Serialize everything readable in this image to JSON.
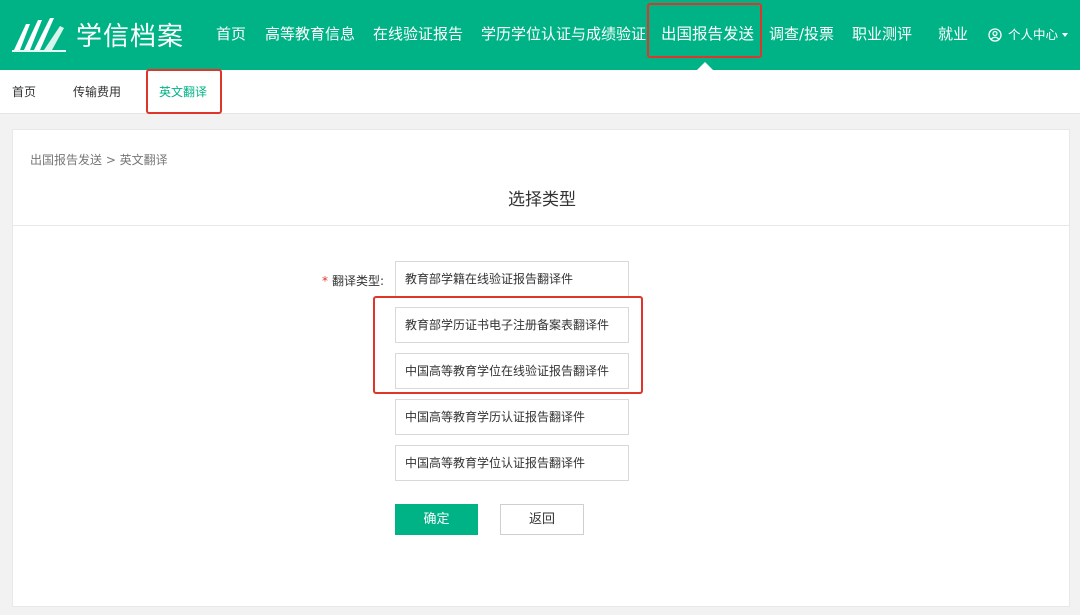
{
  "header": {
    "logo_text": "学信档案",
    "nav": [
      {
        "label": "首页"
      },
      {
        "label": "高等教育信息"
      },
      {
        "label": "在线验证报告"
      },
      {
        "label": "学历学位认证与成绩验证"
      },
      {
        "label": "出国报告发送",
        "active": true
      },
      {
        "label": "调查/投票"
      },
      {
        "label": "职业测评"
      },
      {
        "label": "就业"
      }
    ],
    "user_center": "个人中心",
    "brand_color": "#00b386"
  },
  "subnav": {
    "items": [
      {
        "label": "首页"
      },
      {
        "label": "传输费用"
      },
      {
        "label": "英文翻译",
        "active": true
      }
    ]
  },
  "main": {
    "breadcrumb": "出国报告发送 > 英文翻译",
    "title": "选择类型",
    "form": {
      "required_mark": "*",
      "label": "翻译类型:",
      "options": [
        {
          "label": "教育部学籍在线验证报告翻译件"
        },
        {
          "label": "教育部学历证书电子注册备案表翻译件"
        },
        {
          "label": "中国高等教育学位在线验证报告翻译件"
        },
        {
          "label": "中国高等教育学历认证报告翻译件"
        },
        {
          "label": "中国高等教育学位认证报告翻译件"
        }
      ]
    },
    "buttons": {
      "confirm": "确定",
      "back": "返回"
    }
  },
  "highlight_color": "#e0352b"
}
